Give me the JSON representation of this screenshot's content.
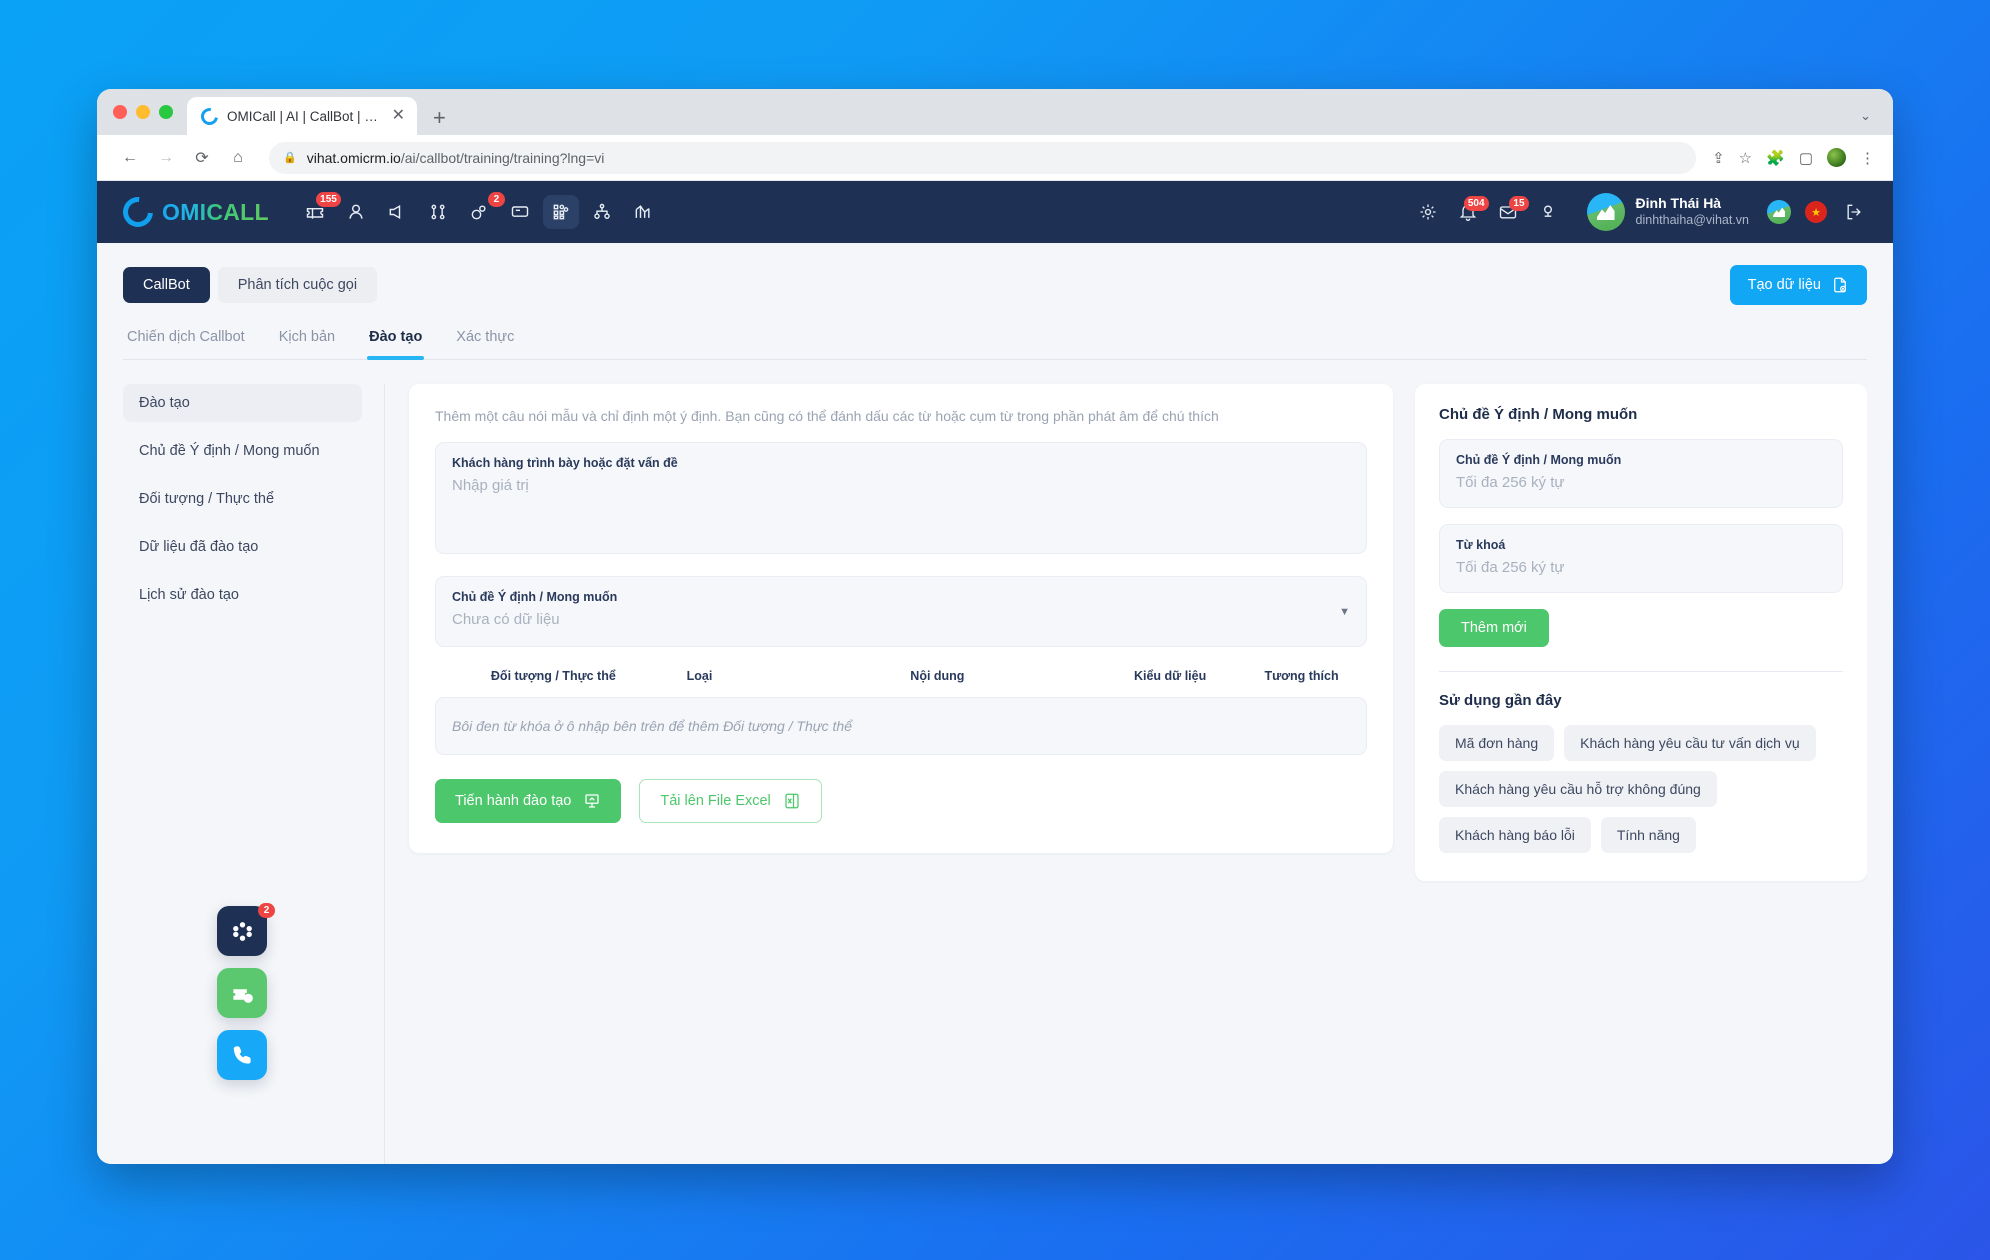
{
  "browser": {
    "tab_title": "OMICall | AI | CallBot | Đào tạo",
    "tab_close": "✕",
    "new_tab": "+",
    "url_domain": "vihat.omicrm.io",
    "url_path": "/ai/callbot/training/training?lng=vi",
    "back": "←",
    "forward": "→",
    "reload": "⟳",
    "home": "⌂",
    "share": "⇪",
    "star": "☆",
    "puzzle": "🧩",
    "sidepanel": "▢",
    "menu": "⋮",
    "window_chevron": "⌄"
  },
  "header": {
    "logo_text": "OMICALL",
    "nav": [
      {
        "name": "tickets-icon",
        "badge": "155"
      },
      {
        "name": "contacts-icon",
        "badge": ""
      },
      {
        "name": "campaign-icon",
        "badge": ""
      },
      {
        "name": "workflow-icon",
        "badge": ""
      },
      {
        "name": "automation-icon",
        "badge": "2"
      },
      {
        "name": "monitor-icon",
        "badge": ""
      },
      {
        "name": "apps-icon",
        "badge": ""
      },
      {
        "name": "org-chart-icon",
        "badge": ""
      },
      {
        "name": "analytics-icon",
        "badge": ""
      }
    ],
    "settings_icon": "gear-icon",
    "notifications_badge": "504",
    "mail_badge": "15",
    "user_name": "Đinh Thái Hà",
    "user_email": "dinhthaiha@vihat.vn",
    "flag_star": "★"
  },
  "page": {
    "segments": [
      {
        "label": "CallBot",
        "active": true
      },
      {
        "label": "Phân tích cuộc gọi",
        "active": false
      }
    ],
    "create_button": "Tạo dữ liệu",
    "subtabs": [
      {
        "label": "Chiến dịch Callbot",
        "active": false
      },
      {
        "label": "Kịch bản",
        "active": false
      },
      {
        "label": "Đào tạo",
        "active": true
      },
      {
        "label": "Xác thực",
        "active": false
      }
    ]
  },
  "sidebar": {
    "items": [
      {
        "label": "Đào tạo",
        "active": true
      },
      {
        "label": "Chủ đề Ý định / Mong muốn",
        "active": false
      },
      {
        "label": "Đối tượng / Thực thể",
        "active": false
      },
      {
        "label": "Dữ liệu đã đào tạo",
        "active": false
      },
      {
        "label": "Lịch sử đào tạo",
        "active": false
      }
    ]
  },
  "main": {
    "hint": "Thêm một câu nói mẫu và chỉ định một ý định. Bạn cũng có thể đánh dấu các từ hoặc cụm từ trong phần phát âm để chú thích",
    "utterance_label": "Khách hàng trình bày hoặc đặt vấn đề",
    "utterance_placeholder": "Nhập giá trị",
    "intent_label": "Chủ đề Ý định / Mong muốn",
    "intent_value": "Chưa có dữ liệu",
    "caret": "▼",
    "table_headers": [
      "Đối tượng / Thực thể",
      "Loại",
      "Nội dung",
      "Kiểu dữ liệu",
      "Tương thích"
    ],
    "empty_text": "Bôi đen từ khóa ở ô nhập bên trên để thêm Đối tượng / Thực thể",
    "train_button": "Tiến hành đào tạo",
    "upload_button": "Tải lên File Excel"
  },
  "right": {
    "title": "Chủ đề Ý định / Mong muốn",
    "intent_field_label": "Chủ đề Ý định / Mong muốn",
    "intent_field_placeholder": "Tối đa 256 ký tự",
    "keyword_field_label": "Từ khoá",
    "keyword_field_placeholder": "Tối đa 256 ký tự",
    "add_button": "Thêm mới",
    "recent_title": "Sử dụng gần đây",
    "recent_tags": [
      "Mã đơn hàng",
      "Khách hàng yêu cầu tư vấn dịch vụ",
      "Khách hàng yêu cầu hỗ trợ không đúng",
      "Khách hàng báo lỗi",
      "Tính năng"
    ]
  },
  "fabs": [
    {
      "name": "settings-fab",
      "badge": "2"
    },
    {
      "name": "ticket-add-fab",
      "badge": ""
    },
    {
      "name": "call-fab",
      "badge": ""
    }
  ],
  "colors": {
    "navy": "#1e3154",
    "accent_blue": "#12a7f5",
    "accent_green": "#4cc76b",
    "badge_red": "#ef4444",
    "tab_underline": "#27b5f3"
  }
}
